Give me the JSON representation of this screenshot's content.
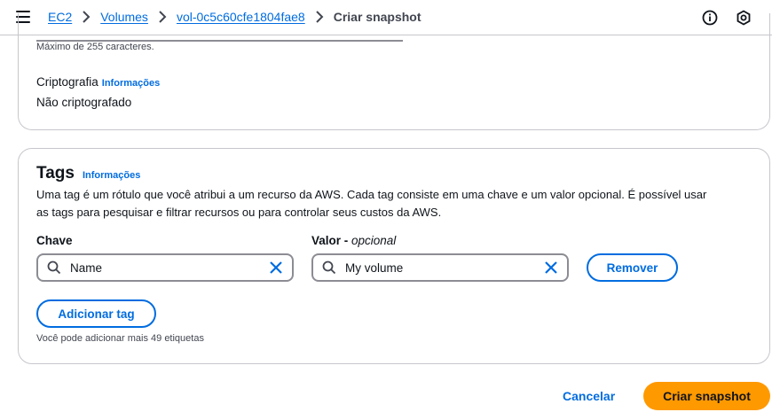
{
  "breadcrumb": {
    "items": [
      "EC2",
      "Volumes",
      "vol-0c5c60cfe1804fae8"
    ],
    "current": "Criar snapshot"
  },
  "header_icons": [
    "info-icon",
    "settings-hex-icon"
  ],
  "details": {
    "max_chars_hint": "Máximo de 255 caracteres.",
    "encryption_label": "Criptografia",
    "encryption_info": "Informações",
    "encryption_value": "Não criptografado"
  },
  "tags": {
    "title": "Tags",
    "info": "Informações",
    "description_line1": "Uma tag é um rótulo que você atribui a um recurso da AWS. Cada tag consiste em uma chave e um valor opcional. É possível usar",
    "description_line2": "as tags para pesquisar e filtrar recursos ou para controlar seus custos da AWS.",
    "key_label": "Chave",
    "value_label": "Valor - ",
    "value_optional": "opcional",
    "key_value": "Name",
    "value_value": "My volume",
    "remove_label": "Remover",
    "add_label": "Adicionar tag",
    "remaining_hint": "Você pode adicionar mais 49 etiquetas"
  },
  "footer": {
    "cancel_label": "Cancelar",
    "submit_label": "Criar snapshot"
  },
  "colors": {
    "link": "#006ce0",
    "primary": "#ff9900",
    "border": "#c6c6cd"
  }
}
